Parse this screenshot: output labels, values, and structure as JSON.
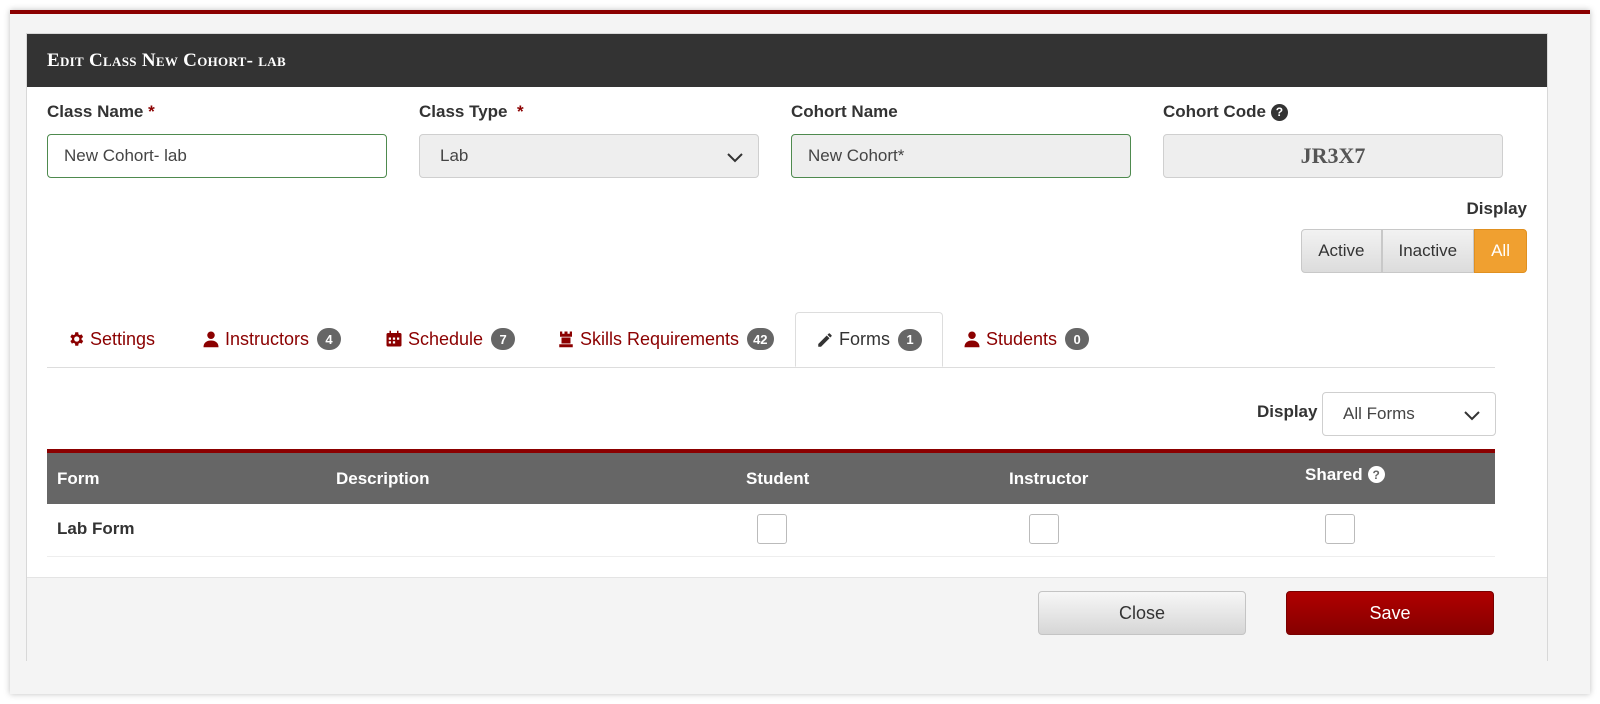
{
  "modal": {
    "title": "Edit Class New Cohort- lab"
  },
  "fields": {
    "class_name": {
      "label": "Class Name",
      "required_mark": "*",
      "value": "New Cohort- lab"
    },
    "class_type": {
      "label": "Class Type",
      "required_mark": "*",
      "value": "Lab"
    },
    "cohort_name": {
      "label": "Cohort Name",
      "value": "New Cohort*"
    },
    "cohort_code": {
      "label": "Cohort Code",
      "help": "?",
      "value": "JR3X7"
    }
  },
  "display_toggle": {
    "label": "Display",
    "options": [
      "Active",
      "Inactive",
      "All"
    ],
    "selected": "All"
  },
  "tabs": [
    {
      "label": "Settings",
      "icon": "gear-icon"
    },
    {
      "label": "Instructors",
      "icon": "user-icon",
      "count": "4"
    },
    {
      "label": "Schedule",
      "icon": "calendar-icon",
      "count": "7"
    },
    {
      "label": "Skills Requirements",
      "icon": "rook-icon",
      "count": "42"
    },
    {
      "label": "Forms",
      "icon": "pencil-icon",
      "count": "1",
      "active": true
    },
    {
      "label": "Students",
      "icon": "user-icon",
      "count": "0"
    }
  ],
  "forms_filter": {
    "label": "Display",
    "value": "All Forms"
  },
  "table": {
    "columns": [
      "Form",
      "Description",
      "Student",
      "Instructor",
      "Shared"
    ],
    "shared_help": "?",
    "rows": [
      {
        "form": "Lab Form",
        "description": "",
        "student": false,
        "instructor": false,
        "shared": false
      }
    ]
  },
  "footer": {
    "close_label": "Close",
    "save_label": "Save"
  },
  "colors": {
    "brand": "#8b0000",
    "header_bg": "#333333",
    "active_toggle": "#f0a030",
    "table_header": "#666666"
  }
}
